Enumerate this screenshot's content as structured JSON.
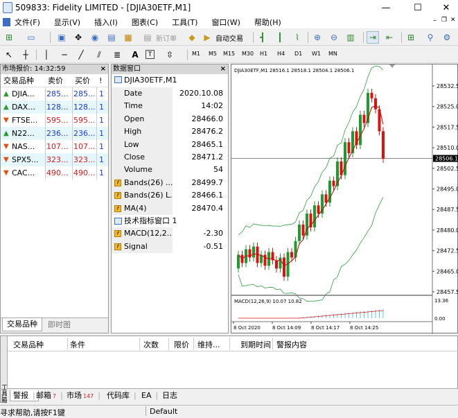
{
  "window": {
    "title": "509833: Fidelity LIMITED - [DJIA30ETF,M1]",
    "controls": [
      "—",
      "☐",
      "✕"
    ]
  },
  "menu": [
    "文件(F)",
    "显示(V)",
    "插入(I)",
    "图表(C)",
    "工具(T)",
    "窗口(W)",
    "帮助(H)"
  ],
  "toolbar": {
    "new_order": "新订单",
    "auto_trade": "自动交易"
  },
  "timeframes": [
    "M1",
    "M5",
    "M15",
    "M30",
    "H1",
    "H4",
    "D1",
    "W1",
    "MN"
  ],
  "market_watch": {
    "title": "市场报价: 14:32:59",
    "headers": [
      "交易品种",
      "卖价",
      "买价",
      "!"
    ],
    "rows": [
      {
        "sym": "DJIA...",
        "bid": "285...",
        "ask": "285...",
        "n": "1",
        "dir": "up"
      },
      {
        "sym": "DAX...",
        "bid": "128...",
        "ask": "128...",
        "n": "1",
        "dir": "up"
      },
      {
        "sym": "FTSE...",
        "bid": "595...",
        "ask": "595...",
        "n": "1",
        "dir": "down"
      },
      {
        "sym": "N22...",
        "bid": "236...",
        "ask": "236...",
        "n": "1",
        "dir": "up"
      },
      {
        "sym": "NAS...",
        "bid": "107...",
        "ask": "107...",
        "n": "1",
        "dir": "down"
      },
      {
        "sym": "SPX5...",
        "bid": "323...",
        "ask": "323...",
        "n": "1",
        "dir": "down"
      },
      {
        "sym": "CAC...",
        "bid": "490...",
        "ask": "490...",
        "n": "1",
        "dir": "down"
      }
    ],
    "tabs": [
      "交易品种",
      "即时图"
    ]
  },
  "data_window": {
    "title": "数据窗口",
    "symbol": "DJIA30ETF,M1",
    "rows": [
      {
        "k": "Date",
        "v": "2020.10.08"
      },
      {
        "k": "Time",
        "v": "14:02"
      },
      {
        "k": "Open",
        "v": "28466.0"
      },
      {
        "k": "High",
        "v": "28476.2"
      },
      {
        "k": "Low",
        "v": "28465.1"
      },
      {
        "k": "Close",
        "v": "28471.2"
      },
      {
        "k": "Volume",
        "v": "54"
      }
    ],
    "indicators": [
      {
        "k": "Bands(26) ...",
        "v": "28499.7"
      },
      {
        "k": "Bands(26) L...",
        "v": "28466.1"
      },
      {
        "k": "MA(4)",
        "v": "28470.4"
      }
    ],
    "sub_window": "技术指标窗口 1",
    "sub_rows": [
      {
        "k": "MACD(12,2...",
        "v": "-2.30"
      },
      {
        "k": "Signal",
        "v": "-0.51"
      }
    ]
  },
  "chart": {
    "header": "DJIA30ETF,M1  28516.1 28518.1 28504.1 28506.1",
    "y_ticks": [
      "28532.5",
      "28525.0",
      "28517.5",
      "28510.0",
      "28502.5",
      "28495.0",
      "28487.5",
      "28480.0",
      "28472.5",
      "28465.0",
      "28457.5"
    ],
    "current_price": "28506.1",
    "macd_label": "MACD(12,26,9) 10.07 10.82",
    "macd_ticks": [
      "13.36",
      "0.00"
    ],
    "x_labels": [
      "8 Oct 2020",
      "8 Oct 14:09",
      "8 Oct 14:17",
      "8 Oct 14:25"
    ],
    "colors": {
      "bull": "#1e9b2f",
      "bear": "#dd1111",
      "ma": "#cc0000",
      "bands": "#2e9e3e",
      "macd": "#5bc8f0",
      "signal": "#dd1111"
    }
  },
  "terminal": {
    "headers": [
      "交易品种",
      "条件",
      "次数",
      "限价",
      "维持...",
      "到期时间",
      "警报内容"
    ],
    "side_label": "工具箱",
    "tabs": [
      {
        "l": "警报",
        "n": ""
      },
      {
        "l": "邮箱",
        "n": "7"
      },
      {
        "l": "市场",
        "n": "147"
      },
      {
        "l": "代码库",
        "n": ""
      },
      {
        "l": "EA",
        "n": ""
      },
      {
        "l": "日志",
        "n": ""
      }
    ]
  },
  "status": {
    "left": "寻求帮助,请按F1键",
    "profile": "Default"
  }
}
